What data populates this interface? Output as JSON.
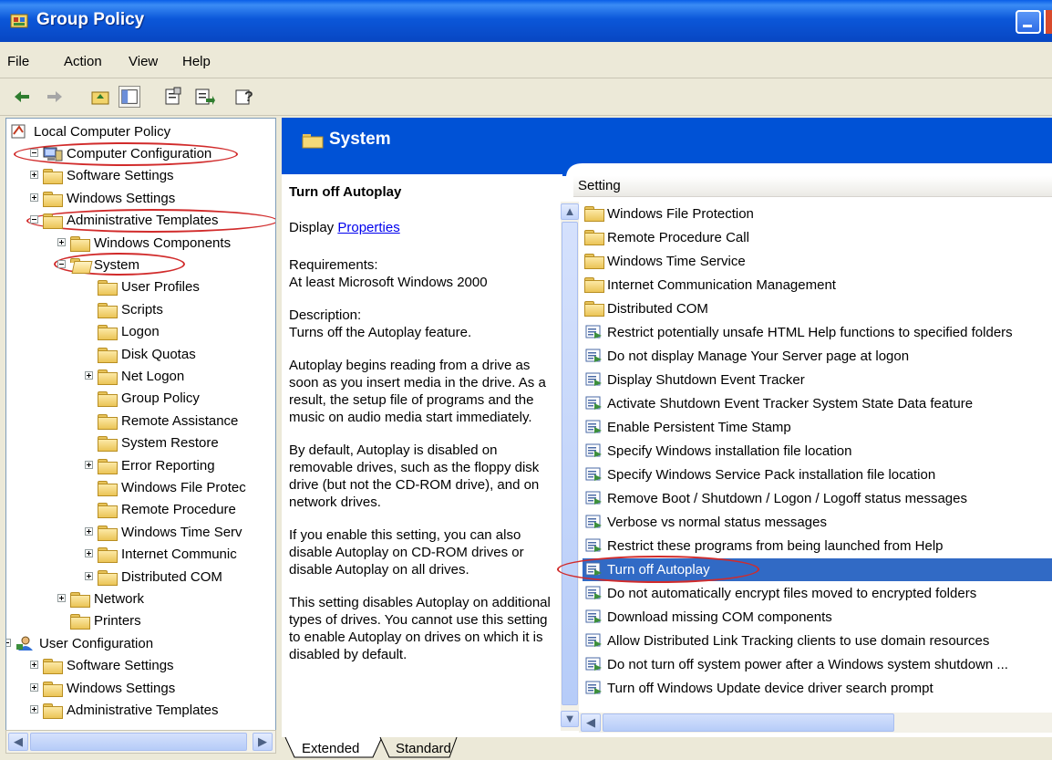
{
  "window": {
    "title": "Group Policy"
  },
  "menu": [
    "File",
    "Action",
    "View",
    "Help"
  ],
  "tree": {
    "root": "Local Computer Policy",
    "nodes": [
      {
        "label": "Computer Configuration"
      },
      {
        "label": "Software Settings"
      },
      {
        "label": "Windows Settings"
      },
      {
        "label": "Administrative Templates"
      },
      {
        "label": "Windows Components"
      },
      {
        "label": "System"
      },
      {
        "label": "User Profiles"
      },
      {
        "label": "Scripts"
      },
      {
        "label": "Logon"
      },
      {
        "label": "Disk Quotas"
      },
      {
        "label": "Net Logon"
      },
      {
        "label": "Group Policy"
      },
      {
        "label": "Remote Assistance"
      },
      {
        "label": "System Restore"
      },
      {
        "label": "Error Reporting"
      },
      {
        "label": "Windows File Protec"
      },
      {
        "label": "Remote Procedure"
      },
      {
        "label": "Windows Time Serv"
      },
      {
        "label": "Internet Communic"
      },
      {
        "label": "Distributed COM"
      },
      {
        "label": "Network"
      },
      {
        "label": "Printers"
      },
      {
        "label": "User Configuration"
      },
      {
        "label": "Software Settings"
      },
      {
        "label": "Windows Settings"
      },
      {
        "label": "Administrative Templates"
      }
    ]
  },
  "pane": {
    "header_title": "System",
    "desc_title": "Turn off Autoplay",
    "display_prefix": "Display ",
    "display_link": "Properties",
    "requirements_label": "Requirements:",
    "requirements": "At least Microsoft Windows 2000",
    "description_label": "Description:",
    "description": "Turns off the Autoplay feature.",
    "para1": "Autoplay begins reading from a drive as soon as you insert media in the drive. As a result, the setup file of programs and the music on audio media start immediately.",
    "para2": "By default, Autoplay is disabled on removable drives, such as the floppy disk drive (but not the CD-ROM drive), and on network drives.",
    "para3": "If you enable this setting, you can also disable Autoplay on CD-ROM drives or disable Autoplay on all drives.",
    "para4": "This setting disables Autoplay on additional types of drives. You cannot use this setting to enable Autoplay on drives on which it is disabled by default."
  },
  "list": {
    "column": "Setting",
    "rows": [
      {
        "label": "Windows File Protection",
        "kind": "folder"
      },
      {
        "label": "Remote Procedure Call",
        "kind": "folder"
      },
      {
        "label": "Windows Time Service",
        "kind": "folder"
      },
      {
        "label": "Internet Communication Management",
        "kind": "folder"
      },
      {
        "label": "Distributed COM",
        "kind": "folder"
      },
      {
        "label": "Restrict potentially unsafe HTML Help functions to specified folders",
        "kind": "setting"
      },
      {
        "label": "Do not display Manage Your Server page at logon",
        "kind": "setting"
      },
      {
        "label": "Display Shutdown Event Tracker",
        "kind": "setting"
      },
      {
        "label": "Activate Shutdown Event Tracker System State Data feature",
        "kind": "setting"
      },
      {
        "label": "Enable Persistent Time Stamp",
        "kind": "setting"
      },
      {
        "label": "Specify Windows installation file location",
        "kind": "setting"
      },
      {
        "label": "Specify Windows Service Pack installation file location",
        "kind": "setting"
      },
      {
        "label": "Remove Boot / Shutdown / Logon / Logoff status messages",
        "kind": "setting"
      },
      {
        "label": "Verbose vs normal status messages",
        "kind": "setting"
      },
      {
        "label": "Restrict these programs from being launched from Help",
        "kind": "setting"
      },
      {
        "label": "Turn off Autoplay",
        "kind": "setting",
        "selected": true
      },
      {
        "label": "Do not automatically encrypt files moved to encrypted folders",
        "kind": "setting"
      },
      {
        "label": "Download missing COM components",
        "kind": "setting"
      },
      {
        "label": "Allow Distributed Link Tracking clients to use domain resources",
        "kind": "setting"
      },
      {
        "label": "Do not turn off system power after a Windows system shutdown ...",
        "kind": "setting"
      },
      {
        "label": "Turn off Windows Update device driver search prompt",
        "kind": "setting"
      }
    ]
  },
  "tabs": [
    "Extended",
    "Standard"
  ],
  "colors": {
    "title_bar": "#0846C2",
    "selection": "#316AC5",
    "header": "#0052D6",
    "annotation": "#D12B2B"
  }
}
